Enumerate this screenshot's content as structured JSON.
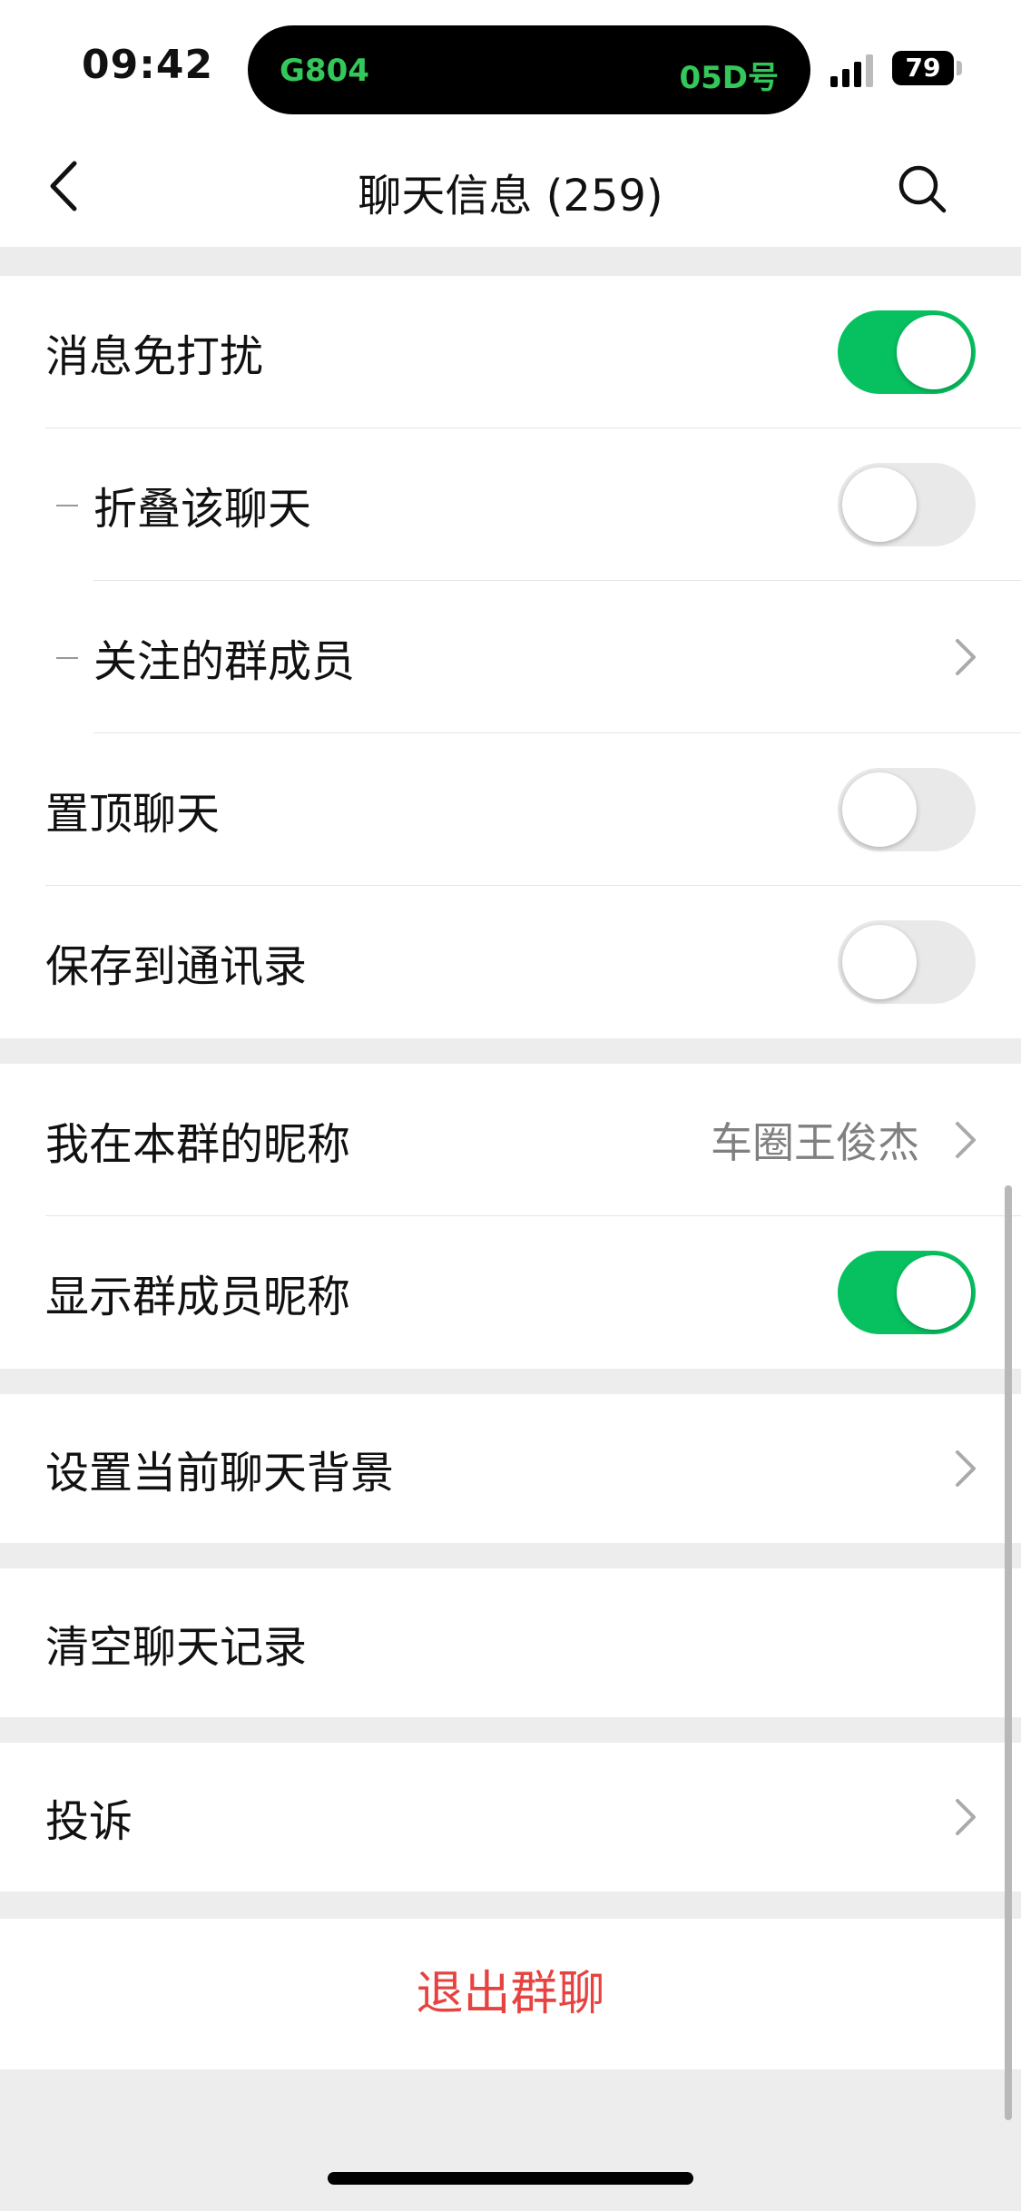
{
  "status_bar": {
    "time": "09:42",
    "island_left": "G804",
    "island_right": "05D号",
    "battery": "79"
  },
  "nav": {
    "title": "聊天信息 (259)",
    "back_icon": "chevron-left-icon",
    "search_icon": "search-icon"
  },
  "colors": {
    "accent_green": "#07c160",
    "danger_red": "#e64340",
    "background": "#ededed"
  },
  "settings": {
    "mute": {
      "label": "消息免打扰",
      "toggle": true
    },
    "fold": {
      "label": "折叠该聊天",
      "toggle": false
    },
    "followed": {
      "label": "关注的群成员"
    },
    "pin": {
      "label": "置顶聊天",
      "toggle": false
    },
    "save_contacts": {
      "label": "保存到通讯录",
      "toggle": false
    },
    "nickname": {
      "label": "我在本群的昵称",
      "value": "车圈王俊杰"
    },
    "show_nicknames": {
      "label": "显示群成员昵称",
      "toggle": true
    },
    "background": {
      "label": "设置当前聊天背景"
    },
    "clear_history": {
      "label": "清空聊天记录"
    },
    "report": {
      "label": "投诉"
    },
    "exit": {
      "label": "退出群聊"
    }
  }
}
